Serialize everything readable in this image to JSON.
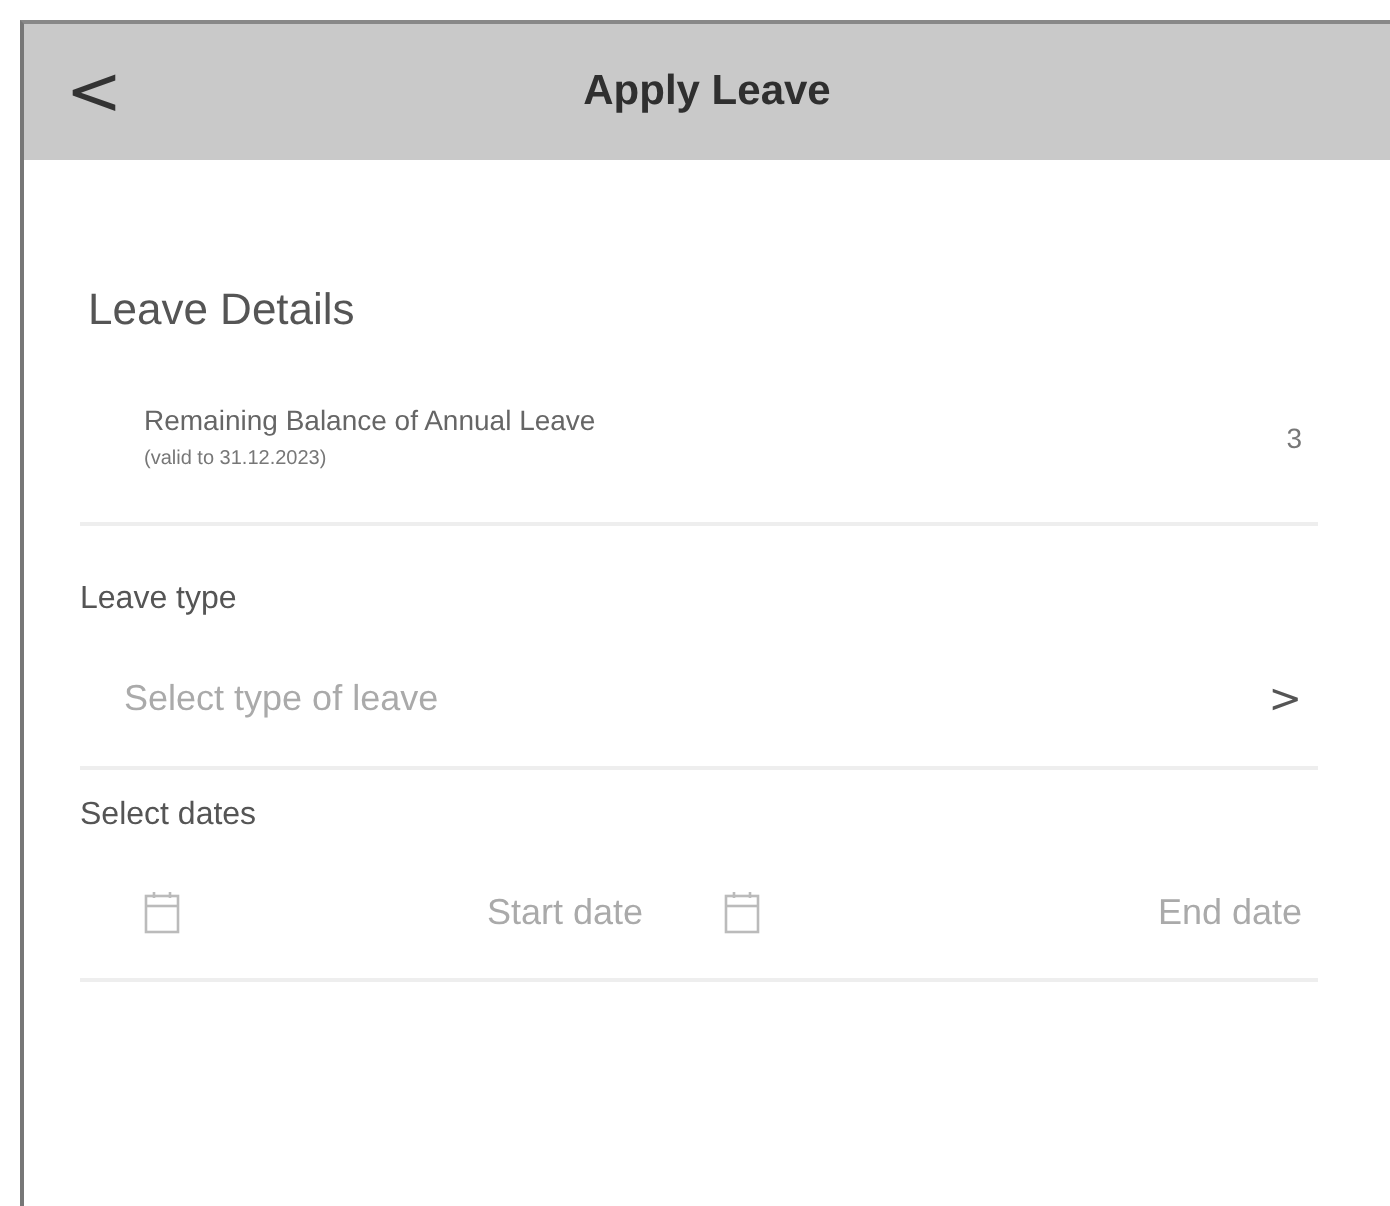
{
  "header": {
    "back": "<",
    "title": "Apply Leave"
  },
  "details": {
    "heading": "Leave Details",
    "balance_label": "Remaining Balance of Annual Leave",
    "balance_note": "(valid to 31.12.2023)",
    "balance_value": "3"
  },
  "leave_type": {
    "label": "Leave type",
    "placeholder": "Select type of leave",
    "chevron": ">"
  },
  "dates": {
    "label": "Select dates",
    "start_placeholder": "Start date",
    "end_placeholder": "End date"
  }
}
